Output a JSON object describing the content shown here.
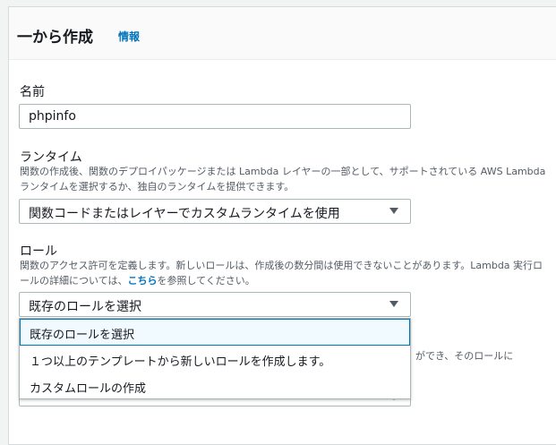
{
  "header": {
    "title": "一から作成",
    "info_link": "情報"
  },
  "name_field": {
    "label": "名前",
    "value": "phpinfo"
  },
  "runtime_field": {
    "label": "ランタイム",
    "description": "関数の作成後、関数のデプロイパッケージまたは Lambda レイヤーの一部として、サポートされている AWS Lambda ランタイムを選択するか、独自のランタイムを提供できます。",
    "selected": "関数コードまたはレイヤーでカスタムランタイムを使用"
  },
  "role_field": {
    "label": "ロール",
    "description_before": "関数のアクセス許可を定義します。新しいロールは、作成後の数分間は使用できないことがあります。Lambda 実行ロールの詳細については、",
    "description_link": "こちら",
    "description_after": "を参照してください。",
    "selected": "既存のロールを選択",
    "options": [
      "既存のロールを選択",
      "１つ以上のテンプレートから新しいロールを作成します。",
      "カスタムロールの作成"
    ]
  },
  "partial_text": "ができ、そのロールに"
}
